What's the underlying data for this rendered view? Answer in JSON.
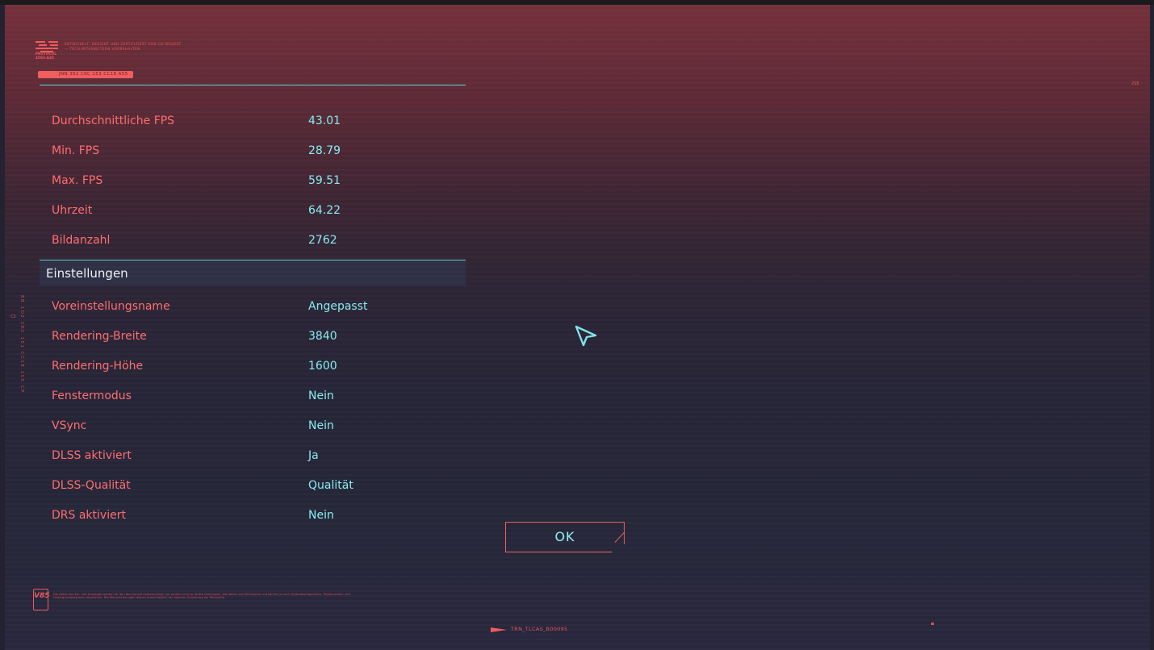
{
  "header": {
    "brand_word": "PROTOCOL 4503-A45",
    "brand_text": "ENTWICKELT, DESIGNT UND ZERTIFIZIERT VON CD PROJEKT — TECH-MITARBEITERN VORBEHALTEN.",
    "tag_code": "JNN 352 CKC 153 CC18 A55",
    "corner_code": "2SE"
  },
  "stats": [
    {
      "label": "Durchschnittliche FPS",
      "value": "43.01"
    },
    {
      "label": "Min. FPS",
      "value": "28.79"
    },
    {
      "label": "Max. FPS",
      "value": "59.51"
    },
    {
      "label": "Uhrzeit",
      "value": "64.22"
    },
    {
      "label": "Bildanzahl",
      "value": "2762"
    }
  ],
  "settings": {
    "title": "Einstellungen",
    "rows": [
      {
        "label": "Voreinstellungsname",
        "value": "Angepasst"
      },
      {
        "label": "Rendering-Breite",
        "value": "3840"
      },
      {
        "label": "Rendering-Höhe",
        "value": "1600"
      },
      {
        "label": "Fenstermodus",
        "value": "Nein"
      },
      {
        "label": "VSync",
        "value": "Nein"
      },
      {
        "label": "DLSS aktiviert",
        "value": "Ja"
      },
      {
        "label": "DLSS-Qualität",
        "value": "Qualität"
      },
      {
        "label": "DRS aktiviert",
        "value": "Nein"
      }
    ]
  },
  "ok_label": "OK",
  "side": {
    "vertical_text": "8R 1O2 CKC 151 CC18 1S5 CP",
    "mark": "C2"
  },
  "footer": {
    "legal_logo": "V85",
    "legal_text": "Die Daten des Ein- und Ausgangs werden für den Benchmark aufgezeichnet; sie werden nicht an Dritte übertragen. Alle Werte sind Richtwerte und können je nach Systemkonfiguration, Treiberversion und Hintergrundprozessen abweichen. Die Kennzeichnungen dienen ausschließlich der internen Zuordnung der Messreihe.",
    "trn_code": "TRN_TLCAS_B00095"
  },
  "colors": {
    "label": "#ff6d6d",
    "value": "#86ecf0",
    "accent_line": "#5fd4e0",
    "red_accent": "#ec5c5c"
  },
  "icons": [
    "protocol-logo-icon",
    "cursor-arrow-icon",
    "arrow-right-icon"
  ]
}
